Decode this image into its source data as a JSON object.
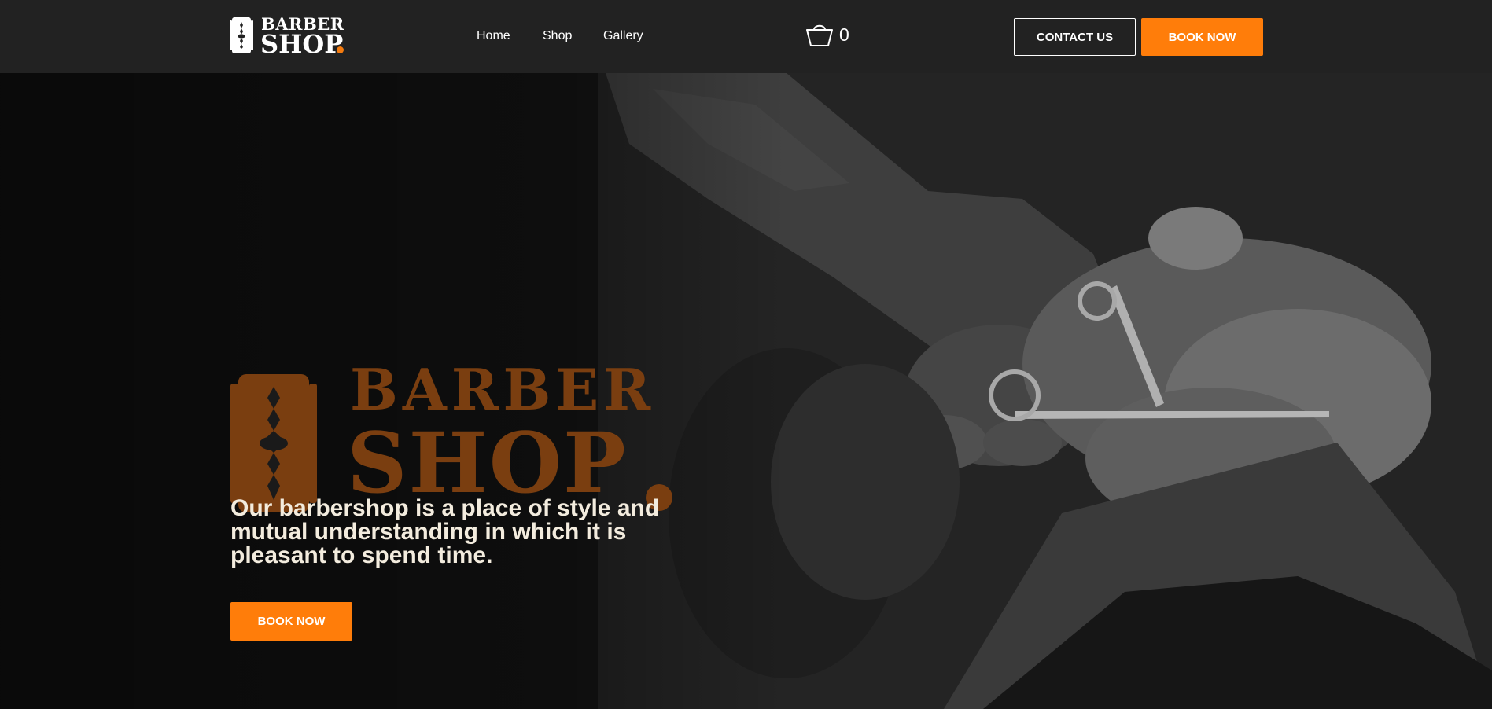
{
  "header": {
    "logo": {
      "top": "BARBER",
      "bottom": "SHOP"
    },
    "nav": [
      {
        "label": "Home"
      },
      {
        "label": "Shop"
      },
      {
        "label": "Gallery"
      }
    ],
    "cart": {
      "icon": "shopping-bag-icon",
      "count": "0"
    },
    "contact_label": "CONTACT US",
    "book_label": "BOOK NOW"
  },
  "hero": {
    "logo": {
      "top": "BARBER",
      "bottom": "SHOP"
    },
    "tagline": "Our barbershop is a place of style and mutual understanding in which it is pleasant to spend time.",
    "book_label": "BOOK NOW",
    "image": "barber-trimming-beard-with-scissors"
  },
  "colors": {
    "accent": "#ff7d0a",
    "header_bg": "#222222",
    "hero_logo": "#7a3e10",
    "tagline": "#f3ecde"
  }
}
